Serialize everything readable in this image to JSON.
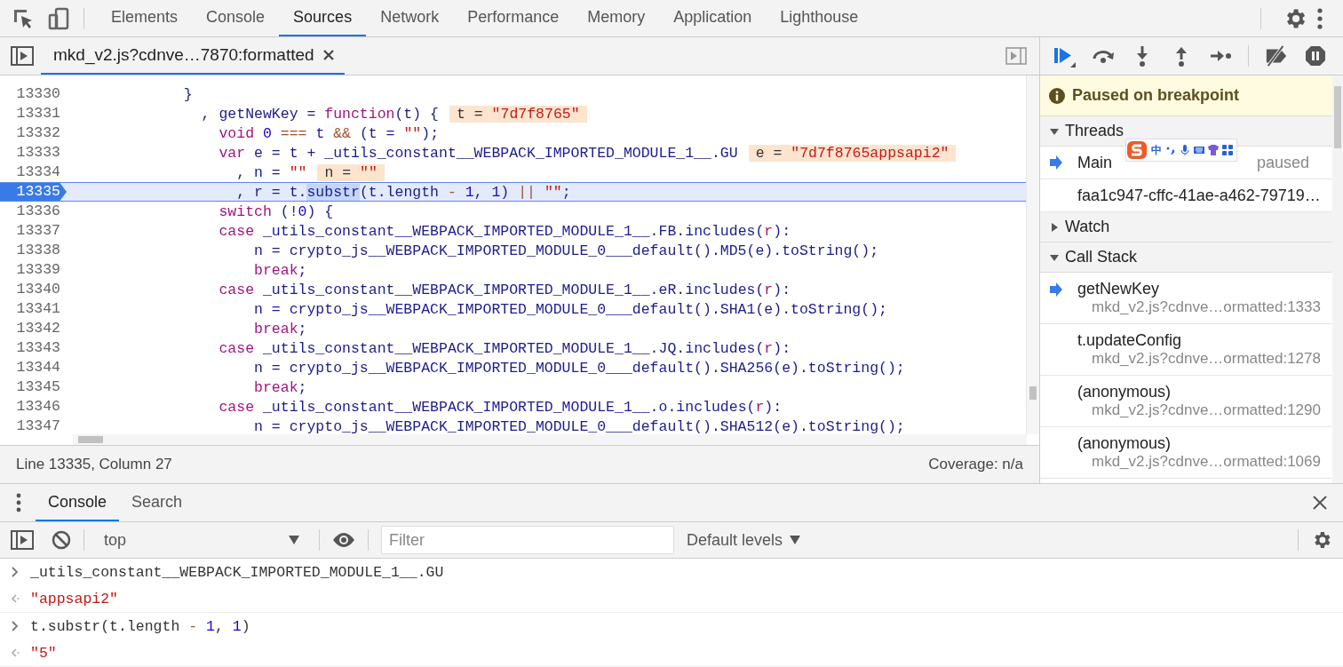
{
  "top_tabs": [
    {
      "label": "Elements",
      "selected": false
    },
    {
      "label": "Console",
      "selected": false
    },
    {
      "label": "Sources",
      "selected": true
    },
    {
      "label": "Network",
      "selected": false
    },
    {
      "label": "Performance",
      "selected": false
    },
    {
      "label": "Memory",
      "selected": false
    },
    {
      "label": "Application",
      "selected": false
    },
    {
      "label": "Lighthouse",
      "selected": false
    }
  ],
  "editor": {
    "file_tab": "mkd_v2.js?cdnve…7870:formatted",
    "lines": [
      {
        "number": "13330",
        "current": false,
        "tokens": [
          {
            "kind": "code",
            "text": "            }"
          }
        ]
      },
      {
        "number": "13331",
        "current": false,
        "tokens": [
          {
            "kind": "code",
            "text": "              , getNewKey = "
          },
          {
            "kind": "keyword",
            "text": "function"
          },
          {
            "kind": "code",
            "text": "(t) {"
          }
        ],
        "inline_value": [
          {
            "kind": "plain",
            "text": "t = "
          },
          {
            "kind": "string",
            "text": "\"7d7f8765\""
          }
        ]
      },
      {
        "number": "13332",
        "current": false,
        "tokens": [
          {
            "kind": "keyword",
            "text": "                void"
          },
          {
            "kind": "number",
            "text": " 0"
          },
          {
            "kind": "operator",
            "text": " === "
          },
          {
            "kind": "code",
            "text": "t "
          },
          {
            "kind": "operator",
            "text": "&&"
          },
          {
            "kind": "code",
            "text": " (t = "
          },
          {
            "kind": "string",
            "text": "\"\""
          },
          {
            "kind": "code",
            "text": ");"
          }
        ]
      },
      {
        "number": "13333",
        "current": false,
        "tokens": [
          {
            "kind": "keyword",
            "text": "                var"
          },
          {
            "kind": "code",
            "text": " e = t + _utils_constant__WEBPACK_IMPORTED_MODULE_1__.GU"
          }
        ],
        "inline_value": [
          {
            "kind": "plain",
            "text": "e = "
          },
          {
            "kind": "string",
            "text": "\"7d7f8765appsapi2\""
          }
        ]
      },
      {
        "number": "13334",
        "current": false,
        "tokens": [
          {
            "kind": "code",
            "text": "                  , n = "
          },
          {
            "kind": "string",
            "text": "\"\""
          }
        ],
        "inline_value": [
          {
            "kind": "plain",
            "text": "n = "
          },
          {
            "kind": "string",
            "text": "\"\""
          }
        ]
      },
      {
        "number": "13335",
        "current": true,
        "tokens": [
          {
            "kind": "code",
            "text": "                  , r = t."
          },
          {
            "kind": "selection",
            "text": "substr"
          },
          {
            "kind": "code",
            "text": "(t.length "
          },
          {
            "kind": "operator",
            "text": "- "
          },
          {
            "kind": "number",
            "text": "1"
          },
          {
            "kind": "code",
            "text": ", "
          },
          {
            "kind": "number",
            "text": "1"
          },
          {
            "kind": "code",
            "text": ") "
          },
          {
            "kind": "operator",
            "text": "|| "
          },
          {
            "kind": "string",
            "text": "\"\""
          },
          {
            "kind": "code",
            "text": ";"
          }
        ]
      },
      {
        "number": "13336",
        "current": false,
        "tokens": [
          {
            "kind": "keyword",
            "text": "                switch"
          },
          {
            "kind": "code",
            "text": " (!"
          },
          {
            "kind": "number",
            "text": "0"
          },
          {
            "kind": "code",
            "text": ") {"
          }
        ]
      },
      {
        "number": "13337",
        "current": false,
        "tokens": [
          {
            "kind": "keyword",
            "text": "                case"
          },
          {
            "kind": "code",
            "text": " _utils_constant__WEBPACK_IMPORTED_MODULE_1__.FB.includes("
          },
          {
            "kind": "variable",
            "text": "r"
          },
          {
            "kind": "code",
            "text": "):"
          }
        ]
      },
      {
        "number": "13338",
        "current": false,
        "tokens": [
          {
            "kind": "code",
            "text": "                    n = crypto_js__WEBPACK_IMPORTED_MODULE_0___default().MD5(e).toString();"
          }
        ]
      },
      {
        "number": "13339",
        "current": false,
        "tokens": [
          {
            "kind": "keyword",
            "text": "                    break"
          },
          {
            "kind": "code",
            "text": ";"
          }
        ]
      },
      {
        "number": "13340",
        "current": false,
        "tokens": [
          {
            "kind": "keyword",
            "text": "                case"
          },
          {
            "kind": "code",
            "text": " _utils_constant__WEBPACK_IMPORTED_MODULE_1__.eR.includes("
          },
          {
            "kind": "variable",
            "text": "r"
          },
          {
            "kind": "code",
            "text": "):"
          }
        ]
      },
      {
        "number": "13341",
        "current": false,
        "tokens": [
          {
            "kind": "code",
            "text": "                    n = crypto_js__WEBPACK_IMPORTED_MODULE_0___default().SHA1(e).toString();"
          }
        ]
      },
      {
        "number": "13342",
        "current": false,
        "tokens": [
          {
            "kind": "keyword",
            "text": "                    break"
          },
          {
            "kind": "code",
            "text": ";"
          }
        ]
      },
      {
        "number": "13343",
        "current": false,
        "tokens": [
          {
            "kind": "keyword",
            "text": "                case"
          },
          {
            "kind": "code",
            "text": " _utils_constant__WEBPACK_IMPORTED_MODULE_1__.JQ.includes("
          },
          {
            "kind": "variable",
            "text": "r"
          },
          {
            "kind": "code",
            "text": "):"
          }
        ]
      },
      {
        "number": "13344",
        "current": false,
        "tokens": [
          {
            "kind": "code",
            "text": "                    n = crypto_js__WEBPACK_IMPORTED_MODULE_0___default().SHA256(e).toString();"
          }
        ]
      },
      {
        "number": "13345",
        "current": false,
        "tokens": [
          {
            "kind": "keyword",
            "text": "                    break"
          },
          {
            "kind": "code",
            "text": ";"
          }
        ]
      },
      {
        "number": "13346",
        "current": false,
        "tokens": [
          {
            "kind": "keyword",
            "text": "                case"
          },
          {
            "kind": "code",
            "text": " _utils_constant__WEBPACK_IMPORTED_MODULE_1__.o.includes("
          },
          {
            "kind": "variable",
            "text": "r"
          },
          {
            "kind": "code",
            "text": "):"
          }
        ]
      },
      {
        "number": "13347",
        "current": false,
        "tokens": [
          {
            "kind": "code",
            "text": "                    n = crypto_js__WEBPACK_IMPORTED_MODULE_0___default().SHA512(e).toString();"
          }
        ]
      }
    ],
    "status_bar": {
      "position": "Line 13335, Column 27",
      "coverage": "Coverage: n/a"
    }
  },
  "debugger": {
    "banner": "Paused on breakpoint",
    "threads": {
      "title": "Threads",
      "expanded": true,
      "items": [
        {
          "name": "Main",
          "status": "paused",
          "current": true
        },
        {
          "name": "faa1c947-cffc-41ae-a462-79719…",
          "current": false
        }
      ]
    },
    "watch": {
      "title": "Watch",
      "expanded": false
    },
    "call_stack": {
      "title": "Call Stack",
      "expanded": true,
      "frames": [
        {
          "function": "getNewKey",
          "location": "mkd_v2.js?cdnve…ormatted:1333",
          "current": true
        },
        {
          "function": "t.updateConfig",
          "location": "mkd_v2.js?cdnve…ormatted:1278",
          "current": false
        },
        {
          "function": "(anonymous)",
          "location": "mkd_v2.js?cdnve…ormatted:1290",
          "current": false
        },
        {
          "function": "(anonymous)",
          "location": "mkd_v2.js?cdnve…ormatted:1069",
          "current": false
        }
      ]
    }
  },
  "ime_toolbar": {
    "mode": "中"
  },
  "drawer": {
    "tabs": [
      {
        "label": "Console",
        "selected": true
      },
      {
        "label": "Search",
        "selected": false
      }
    ],
    "context": "top",
    "filter": {
      "placeholder": "Filter"
    },
    "levels": "Default levels",
    "messages": [
      {
        "kind": "input",
        "tokens": [
          {
            "kind": "plain",
            "text": "_utils_constant__WEBPACK_IMPORTED_MODULE_1__.GU"
          }
        ]
      },
      {
        "kind": "output",
        "tokens": [
          {
            "kind": "string",
            "text": "\"appsapi2\""
          }
        ]
      },
      {
        "kind": "input",
        "tokens": [
          {
            "kind": "plain",
            "text": "t.substr(t.length "
          },
          {
            "kind": "operator",
            "text": "- "
          },
          {
            "kind": "number",
            "text": "1"
          },
          {
            "kind": "plain",
            "text": ", "
          },
          {
            "kind": "number",
            "text": "1"
          },
          {
            "kind": "plain",
            "text": ")"
          }
        ]
      },
      {
        "kind": "output",
        "tokens": [
          {
            "kind": "string",
            "text": "\"5\""
          }
        ]
      }
    ]
  }
}
